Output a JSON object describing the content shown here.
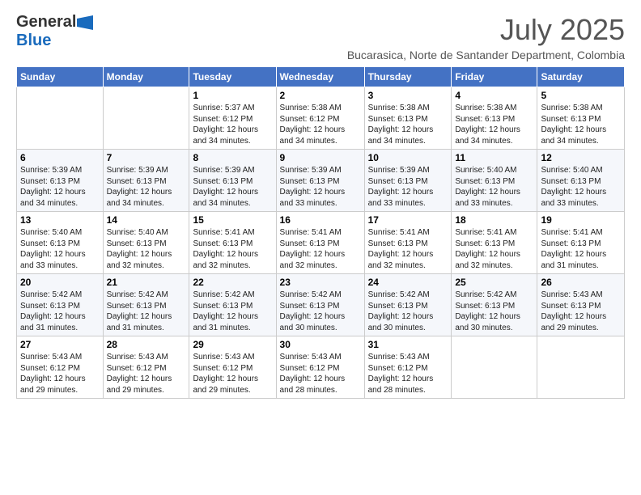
{
  "logo": {
    "general": "General",
    "blue": "Blue"
  },
  "title": {
    "month_year": "July 2025",
    "location": "Bucarasica, Norte de Santander Department, Colombia"
  },
  "weekdays": [
    "Sunday",
    "Monday",
    "Tuesday",
    "Wednesday",
    "Thursday",
    "Friday",
    "Saturday"
  ],
  "weeks": [
    [
      {
        "day": "",
        "info": ""
      },
      {
        "day": "",
        "info": ""
      },
      {
        "day": "1",
        "info": "Sunrise: 5:37 AM\nSunset: 6:12 PM\nDaylight: 12 hours and 34 minutes."
      },
      {
        "day": "2",
        "info": "Sunrise: 5:38 AM\nSunset: 6:12 PM\nDaylight: 12 hours and 34 minutes."
      },
      {
        "day": "3",
        "info": "Sunrise: 5:38 AM\nSunset: 6:13 PM\nDaylight: 12 hours and 34 minutes."
      },
      {
        "day": "4",
        "info": "Sunrise: 5:38 AM\nSunset: 6:13 PM\nDaylight: 12 hours and 34 minutes."
      },
      {
        "day": "5",
        "info": "Sunrise: 5:38 AM\nSunset: 6:13 PM\nDaylight: 12 hours and 34 minutes."
      }
    ],
    [
      {
        "day": "6",
        "info": "Sunrise: 5:39 AM\nSunset: 6:13 PM\nDaylight: 12 hours and 34 minutes."
      },
      {
        "day": "7",
        "info": "Sunrise: 5:39 AM\nSunset: 6:13 PM\nDaylight: 12 hours and 34 minutes."
      },
      {
        "day": "8",
        "info": "Sunrise: 5:39 AM\nSunset: 6:13 PM\nDaylight: 12 hours and 34 minutes."
      },
      {
        "day": "9",
        "info": "Sunrise: 5:39 AM\nSunset: 6:13 PM\nDaylight: 12 hours and 33 minutes."
      },
      {
        "day": "10",
        "info": "Sunrise: 5:39 AM\nSunset: 6:13 PM\nDaylight: 12 hours and 33 minutes."
      },
      {
        "day": "11",
        "info": "Sunrise: 5:40 AM\nSunset: 6:13 PM\nDaylight: 12 hours and 33 minutes."
      },
      {
        "day": "12",
        "info": "Sunrise: 5:40 AM\nSunset: 6:13 PM\nDaylight: 12 hours and 33 minutes."
      }
    ],
    [
      {
        "day": "13",
        "info": "Sunrise: 5:40 AM\nSunset: 6:13 PM\nDaylight: 12 hours and 33 minutes."
      },
      {
        "day": "14",
        "info": "Sunrise: 5:40 AM\nSunset: 6:13 PM\nDaylight: 12 hours and 32 minutes."
      },
      {
        "day": "15",
        "info": "Sunrise: 5:41 AM\nSunset: 6:13 PM\nDaylight: 12 hours and 32 minutes."
      },
      {
        "day": "16",
        "info": "Sunrise: 5:41 AM\nSunset: 6:13 PM\nDaylight: 12 hours and 32 minutes."
      },
      {
        "day": "17",
        "info": "Sunrise: 5:41 AM\nSunset: 6:13 PM\nDaylight: 12 hours and 32 minutes."
      },
      {
        "day": "18",
        "info": "Sunrise: 5:41 AM\nSunset: 6:13 PM\nDaylight: 12 hours and 32 minutes."
      },
      {
        "day": "19",
        "info": "Sunrise: 5:41 AM\nSunset: 6:13 PM\nDaylight: 12 hours and 31 minutes."
      }
    ],
    [
      {
        "day": "20",
        "info": "Sunrise: 5:42 AM\nSunset: 6:13 PM\nDaylight: 12 hours and 31 minutes."
      },
      {
        "day": "21",
        "info": "Sunrise: 5:42 AM\nSunset: 6:13 PM\nDaylight: 12 hours and 31 minutes."
      },
      {
        "day": "22",
        "info": "Sunrise: 5:42 AM\nSunset: 6:13 PM\nDaylight: 12 hours and 31 minutes."
      },
      {
        "day": "23",
        "info": "Sunrise: 5:42 AM\nSunset: 6:13 PM\nDaylight: 12 hours and 30 minutes."
      },
      {
        "day": "24",
        "info": "Sunrise: 5:42 AM\nSunset: 6:13 PM\nDaylight: 12 hours and 30 minutes."
      },
      {
        "day": "25",
        "info": "Sunrise: 5:42 AM\nSunset: 6:13 PM\nDaylight: 12 hours and 30 minutes."
      },
      {
        "day": "26",
        "info": "Sunrise: 5:43 AM\nSunset: 6:13 PM\nDaylight: 12 hours and 29 minutes."
      }
    ],
    [
      {
        "day": "27",
        "info": "Sunrise: 5:43 AM\nSunset: 6:12 PM\nDaylight: 12 hours and 29 minutes."
      },
      {
        "day": "28",
        "info": "Sunrise: 5:43 AM\nSunset: 6:12 PM\nDaylight: 12 hours and 29 minutes."
      },
      {
        "day": "29",
        "info": "Sunrise: 5:43 AM\nSunset: 6:12 PM\nDaylight: 12 hours and 29 minutes."
      },
      {
        "day": "30",
        "info": "Sunrise: 5:43 AM\nSunset: 6:12 PM\nDaylight: 12 hours and 28 minutes."
      },
      {
        "day": "31",
        "info": "Sunrise: 5:43 AM\nSunset: 6:12 PM\nDaylight: 12 hours and 28 minutes."
      },
      {
        "day": "",
        "info": ""
      },
      {
        "day": "",
        "info": ""
      }
    ]
  ]
}
